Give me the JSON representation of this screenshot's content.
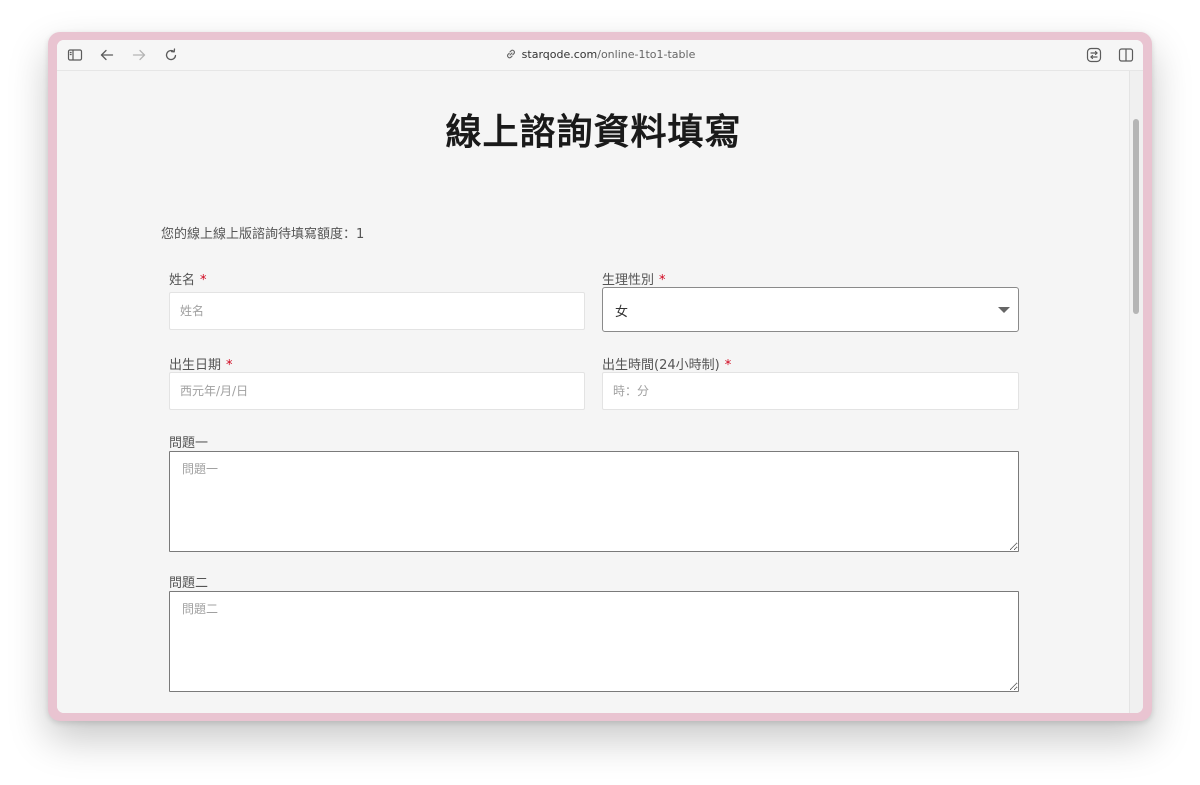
{
  "browser": {
    "url_host": "starqode.com",
    "url_path": "/online-1to1-table"
  },
  "page": {
    "title": "線上諮詢資料填寫",
    "quota_text": "您的線上線上版諮詢待填寫額度：1"
  },
  "form": {
    "name": {
      "label": "姓名",
      "required_mark": "*",
      "placeholder": "姓名"
    },
    "sex": {
      "label": "生理性別",
      "required_mark": "*",
      "selected": "女"
    },
    "birth_date": {
      "label": "出生日期",
      "required_mark": "*",
      "placeholder": "西元年/月/日"
    },
    "birth_time": {
      "label": "出生時間(24小時制)",
      "required_mark": "*",
      "placeholder": "時：分"
    },
    "question1": {
      "label": "問題一",
      "placeholder": "問題一"
    },
    "question2": {
      "label": "問題二",
      "placeholder": "問題二"
    }
  },
  "colors": {
    "required": "#d0021b",
    "window_frame": "#e9c4d1"
  },
  "icons": [
    "sidebar-icon",
    "back-arrow-icon",
    "forward-arrow-icon",
    "reload-icon",
    "link-icon",
    "reader-icon",
    "split-view-icon"
  ]
}
